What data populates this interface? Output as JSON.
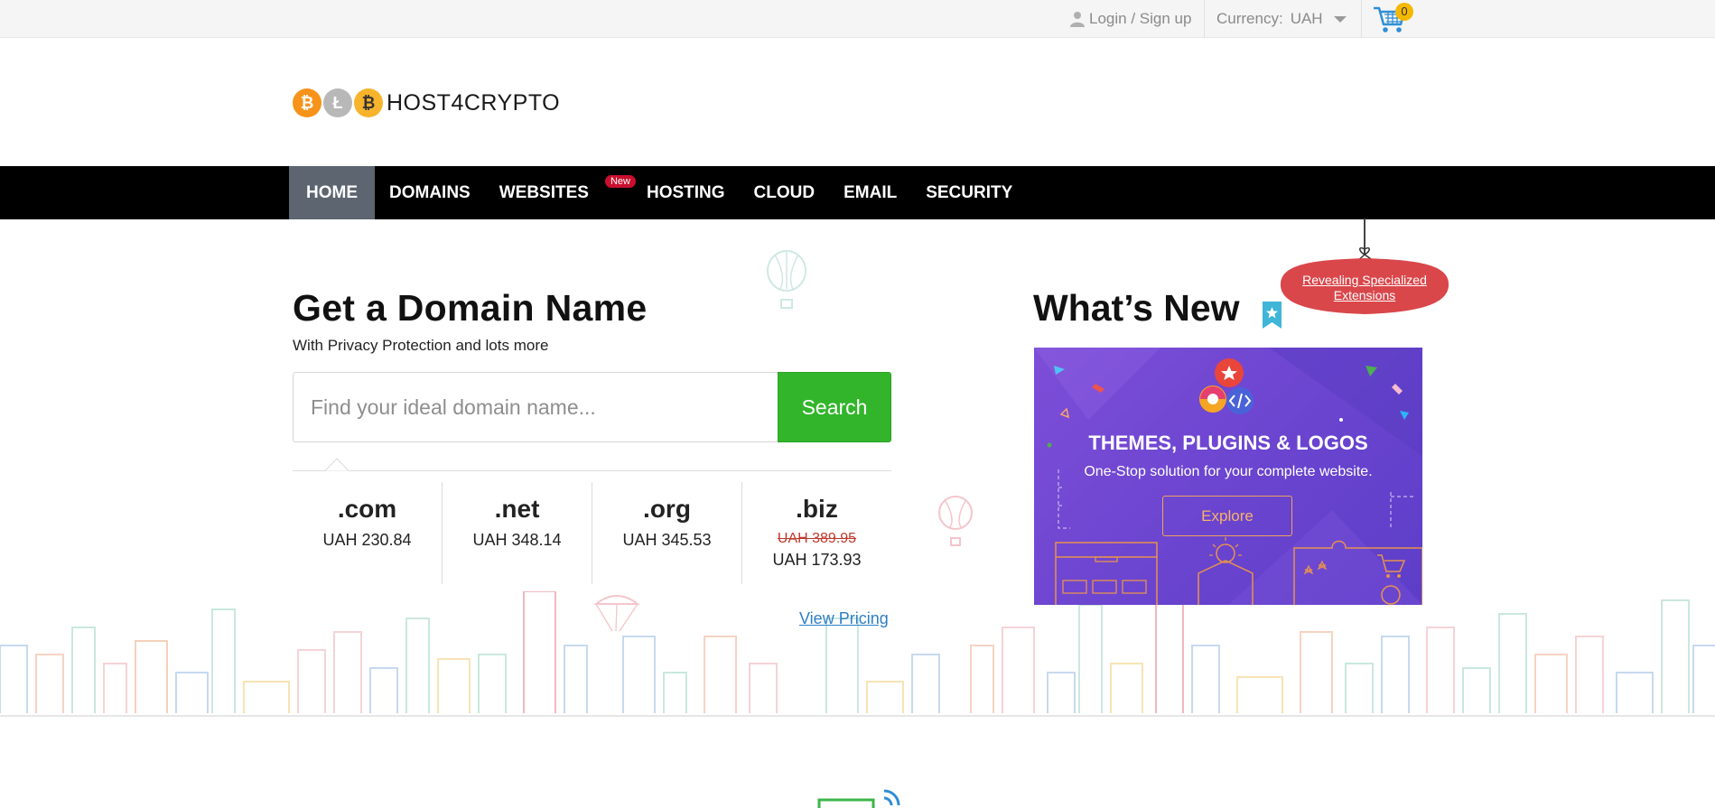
{
  "topbar": {
    "login_label": "Login / Sign up",
    "currency_label": "Currency:",
    "currency_value": "UAH",
    "cart_count": "0"
  },
  "logo": {
    "text": "HOST4CRYPTO",
    "coins": [
      "bitcoin-coin",
      "litecoin-coin",
      "crypto-coin"
    ]
  },
  "nav": {
    "items": [
      {
        "label": "HOME"
      },
      {
        "label": "DOMAINS"
      },
      {
        "label": "WEBSITES",
        "badge": "New"
      },
      {
        "label": "HOSTING"
      },
      {
        "label": "CLOUD"
      },
      {
        "label": "EMAIL"
      },
      {
        "label": "SECURITY"
      }
    ]
  },
  "domain": {
    "title": "Get a Domain Name",
    "subtitle": "With Privacy Protection and lots more",
    "search_placeholder": "Find your ideal domain name...",
    "search_button": "Search",
    "tlds": [
      {
        "name": ".com",
        "price": "UAH 230.84"
      },
      {
        "name": ".net",
        "price": "UAH 348.14"
      },
      {
        "name": ".org",
        "price": "UAH 345.53"
      },
      {
        "name": ".biz",
        "old_price": "UAH 389.95",
        "price": "UAH 173.93"
      }
    ],
    "view_pricing": "View Pricing"
  },
  "whats_new": {
    "title": "What’s New",
    "tag_text": "Revealing Specialized Extensions",
    "banner": {
      "title": "THEMES, PLUGINS & LOGOS",
      "subtitle": "One-Stop solution for your complete website.",
      "button": "Explore"
    }
  },
  "colors": {
    "nav_bg": "#000000",
    "nav_active": "#5c6570",
    "search_button": "#32b52b",
    "banner_bg": "#6a44cf",
    "tag_red": "#d9474b",
    "link_blue": "#2d7fc7",
    "badge_red": "#c8102e"
  }
}
